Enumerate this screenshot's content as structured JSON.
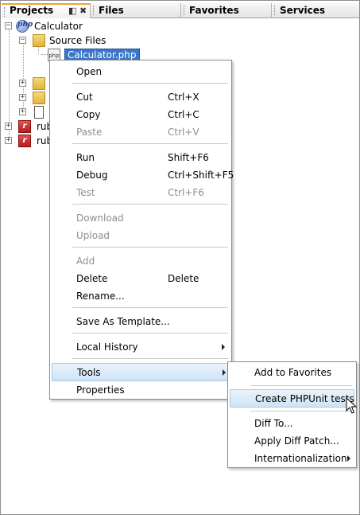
{
  "tabs": [
    {
      "label": "Projects"
    },
    {
      "label": "Files"
    },
    {
      "label": "Favorites"
    },
    {
      "label": "Services"
    }
  ],
  "tab_controls": {
    "restore": "◧",
    "close": "✖"
  },
  "tree": {
    "root_label": "Calculator",
    "root_icon_text": "php",
    "source_files": "Source Files",
    "selected_file": "Calculator.php",
    "file_icon_text": "php",
    "rub_1": "rub",
    "rub_2": "rub"
  },
  "context_menu": {
    "open": "Open",
    "cut": "Cut",
    "cut_shortcut": "Ctrl+X",
    "copy": "Copy",
    "copy_shortcut": "Ctrl+C",
    "paste": "Paste",
    "paste_shortcut": "Ctrl+V",
    "run": "Run",
    "run_shortcut": "Shift+F6",
    "debug": "Debug",
    "debug_shortcut": "Ctrl+Shift+F5",
    "test": "Test",
    "test_shortcut": "Ctrl+F6",
    "download": "Download",
    "upload": "Upload",
    "add": "Add",
    "delete": "Delete",
    "delete_shortcut": "Delete",
    "rename": "Rename...",
    "save_as_template": "Save As Template...",
    "local_history": "Local History",
    "tools": "Tools",
    "properties": "Properties"
  },
  "tools_submenu": {
    "add_to_favorites": "Add to Favorites",
    "create_phpunit_tests": "Create PHPUnit tests",
    "diff_to": "Diff To...",
    "apply_diff_patch": "Apply Diff Patch...",
    "internationalization": "Internationalization"
  },
  "colors": {
    "selection": "#3c76c8",
    "menu_highlight": "#cfe3f4",
    "active_tab_accent": "#f0a030",
    "disabled_text": "#8f8f8f"
  }
}
